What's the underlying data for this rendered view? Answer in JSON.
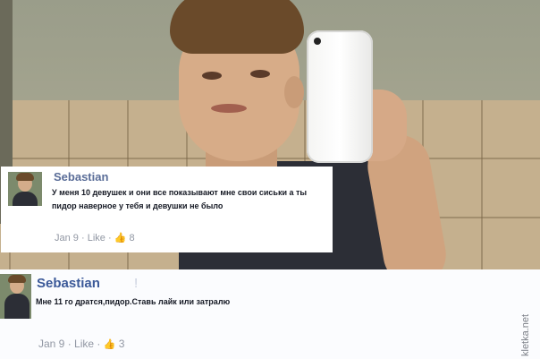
{
  "comments": [
    {
      "author": "Sebastian",
      "text": "У меня 10 девушек и они все показывают мне свои сиськи а ты пидор наверное у тебя и девушки не было",
      "date": "Jan 9",
      "separator": "·",
      "like_label": "Like",
      "likes": "8"
    },
    {
      "author": "Sebastian",
      "author_extra": "!",
      "text": "Мне 11 го дратся,пидор.Ставь лайк или затралю",
      "date": "Jan 9",
      "separator": "·",
      "like_label": "Like",
      "likes": "3"
    }
  ],
  "watermark": "kletka.net",
  "icons": {
    "like": "thumbs-up-icon",
    "phone_logo": "apple-logo-icon"
  },
  "colors": {
    "author_link": "#3b5998",
    "meta_text": "#9197a3",
    "comment_bg": "#ffffff"
  }
}
